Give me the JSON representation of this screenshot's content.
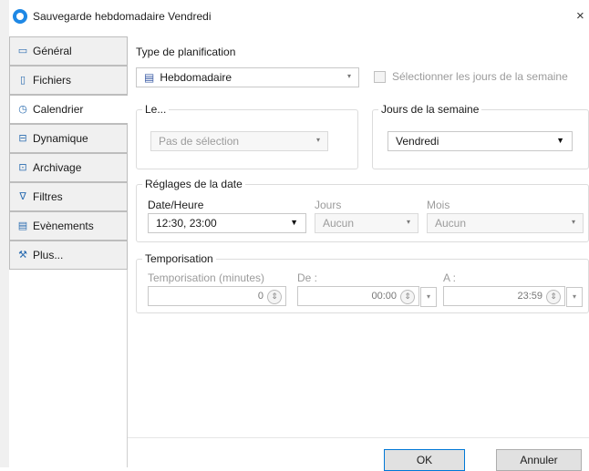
{
  "window": {
    "title": "Sauvegarde hebdomadaire Vendredi",
    "close_glyph": "×"
  },
  "sidebar": {
    "items": [
      {
        "label": "Général",
        "icon": "monitor-icon",
        "glyph": "▭"
      },
      {
        "label": "Fichiers",
        "icon": "file-icon",
        "glyph": "▯"
      },
      {
        "label": "Calendrier",
        "icon": "clock-icon",
        "glyph": "◷",
        "active": true
      },
      {
        "label": "Dynamique",
        "icon": "dynamic-icon",
        "glyph": "⊟"
      },
      {
        "label": "Archivage",
        "icon": "archive-icon",
        "glyph": "⊡"
      },
      {
        "label": "Filtres",
        "icon": "filter-icon",
        "glyph": "∇"
      },
      {
        "label": "Evènements",
        "icon": "calendar-icon",
        "glyph": "▤"
      },
      {
        "label": "Plus...",
        "icon": "wrench-icon",
        "glyph": "⚒"
      }
    ]
  },
  "planification": {
    "label": "Type de planification",
    "type_value": "Hebdomadaire",
    "type_icon": "calendar-icon",
    "select_days_label": "Sélectionner les jours de la semaine",
    "select_days_checked": false
  },
  "le_group": {
    "title": "Le...",
    "value": "Pas de sélection"
  },
  "jours_group": {
    "title": "Jours de la semaine",
    "value": "Vendredi"
  },
  "date_settings": {
    "title": "Réglages de la date",
    "date_label": "Date/Heure",
    "date_value": "12:30, 23:00",
    "jours_label": "Jours",
    "jours_value": "Aucun",
    "mois_label": "Mois",
    "mois_value": "Aucun"
  },
  "temporisation": {
    "title": "Temporisation",
    "minutes_label": "Temporisation (minutes)",
    "minutes_value": "0",
    "from_label": "De :",
    "from_value": "00:00",
    "to_label": "A :",
    "to_value": "23:59"
  },
  "buttons": {
    "ok": "OK",
    "cancel": "Annuler"
  },
  "colors": {
    "accent": "#0078d7",
    "app_icon": "#1e88e5"
  }
}
